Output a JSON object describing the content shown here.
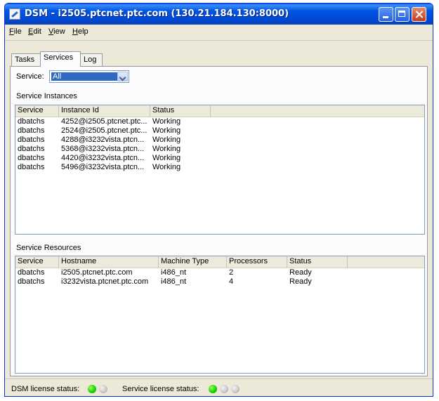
{
  "window": {
    "title": "DSM - i2505.ptcnet.ptc.com (130.21.184.130:8000)"
  },
  "menu": [
    "File",
    "Edit",
    "View",
    "Help"
  ],
  "tabs": [
    "Tasks",
    "Services",
    "Log"
  ],
  "active_tab": "Services",
  "service_filter": {
    "label": "Service:",
    "value": "All"
  },
  "instances": {
    "label": "Service Instances",
    "columns": [
      "Service",
      "Instance Id",
      "Status",
      ""
    ],
    "rows": [
      [
        "dbatchs",
        "4252@i2505.ptcnet.ptc...",
        "Working"
      ],
      [
        "dbatchs",
        "2524@i2505.ptcnet.ptc...",
        "Working"
      ],
      [
        "dbatchs",
        "4288@i3232vista.ptcn...",
        "Working"
      ],
      [
        "dbatchs",
        "5368@i3232vista.ptcn...",
        "Working"
      ],
      [
        "dbatchs",
        "4420@i3232vista.ptcn...",
        "Working"
      ],
      [
        "dbatchs",
        "5496@i3232vista.ptcn...",
        "Working"
      ]
    ]
  },
  "resources": {
    "label": "Service Resources",
    "columns": [
      "Service",
      "Hostname",
      "Machine Type",
      "Processors",
      "Status",
      ""
    ],
    "rows": [
      [
        "dbatchs",
        "i2505.ptcnet.ptc.com",
        "i486_nt",
        "2",
        "Ready"
      ],
      [
        "dbatchs",
        "i3232vista.ptcnet.ptc.com",
        "i486_nt",
        "4",
        "Ready"
      ]
    ]
  },
  "status": {
    "dsm_label": "DSM license status:",
    "dsm_leds": [
      "green",
      "gray"
    ],
    "service_label": "Service license status:",
    "service_leds": [
      "green",
      "gray",
      "gray"
    ],
    "colors": {
      "green": "#19d400",
      "gray": "#c5c5c5"
    }
  }
}
